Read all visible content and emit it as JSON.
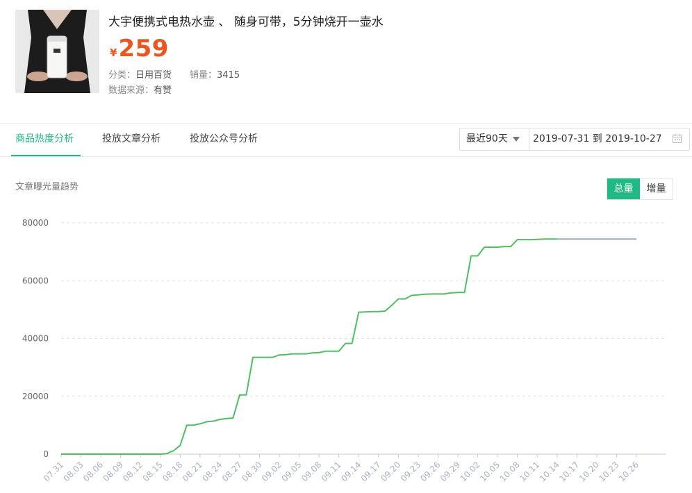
{
  "product": {
    "title": "大宇便携式电热水壶 、 随身可带，5分钟烧开一壶水",
    "currency": "¥",
    "price": "259",
    "category_label": "分类：",
    "category_value": "日用百货",
    "sales_label": "销量：",
    "sales_value": "3415",
    "source_label": "数据来源：",
    "source_value": "有赞",
    "price_color": "#f0541e"
  },
  "tabs": [
    {
      "label": "商品热度分析",
      "active": true
    },
    {
      "label": "投放文章分析",
      "active": false
    },
    {
      "label": "投放公众号分析",
      "active": false
    }
  ],
  "range": {
    "preset": "最近90天",
    "dates": "2019-07-31 到 2019-10-27",
    "icon": "calendar-icon"
  },
  "section": {
    "title": "文章曝光量趋势",
    "toggle": {
      "total": "总量",
      "increment": "增量",
      "selected": "总量"
    }
  },
  "accent_color": "#1fba84",
  "chart_data": {
    "type": "line",
    "title": "",
    "xlabel": "",
    "ylabel": "",
    "ylim": [
      0,
      80000
    ],
    "yticks": [
      0,
      20000,
      40000,
      60000,
      80000
    ],
    "grid": true,
    "xtick_labels": [
      "07.31",
      "08.03",
      "08.06",
      "08.09",
      "08.12",
      "08.15",
      "08.18",
      "08.21",
      "08.24",
      "08.27",
      "08.30",
      "09.02",
      "09.05",
      "09.08",
      "09.11",
      "09.14",
      "09.17",
      "09.20",
      "09.23",
      "09.26",
      "09.29",
      "10.02",
      "10.05",
      "10.08",
      "10.11",
      "10.14",
      "10.17",
      "10.20",
      "10.23",
      "10.26"
    ],
    "series": [
      {
        "color": "#4cbf60",
        "x": [
          "07.31",
          "08.15",
          "08.16",
          "08.17",
          "08.18",
          "08.19",
          "08.20",
          "08.21",
          "08.22",
          "08.23",
          "08.24",
          "08.25",
          "08.26",
          "08.27",
          "08.28",
          "08.29",
          "08.30",
          "09.01",
          "09.02",
          "09.03",
          "09.04",
          "09.05",
          "09.06",
          "09.07",
          "09.08",
          "09.09",
          "09.10",
          "09.11",
          "09.12",
          "09.13",
          "09.14",
          "09.15",
          "09.16",
          "09.17",
          "09.18",
          "09.19",
          "09.20",
          "09.21",
          "09.22",
          "09.23",
          "09.24",
          "09.25",
          "09.26",
          "09.27",
          "09.28",
          "09.29",
          "09.30",
          "10.01",
          "10.02",
          "10.03",
          "10.04",
          "10.05",
          "10.06",
          "10.07",
          "10.08",
          "10.09",
          "10.10",
          "10.11",
          "10.12",
          "10.13",
          "10.14"
        ],
        "values": [
          0,
          0,
          200,
          1200,
          3000,
          10000,
          10000,
          10500,
          11200,
          11400,
          12000,
          12300,
          12500,
          20500,
          20500,
          33500,
          33500,
          33500,
          34300,
          34400,
          34700,
          34700,
          34700,
          35000,
          35100,
          35600,
          35600,
          35600,
          38300,
          38300,
          49100,
          49200,
          49300,
          49300,
          49500,
          51500,
          53700,
          53700,
          54900,
          55100,
          55300,
          55400,
          55400,
          55400,
          55800,
          55900,
          55900,
          68600,
          68600,
          71600,
          71600,
          71600,
          71800,
          71800,
          74200,
          74200,
          74200,
          74300,
          74400,
          74400,
          74400
        ]
      },
      {
        "color": "#9aa9bd",
        "x": [
          "10.14",
          "10.26"
        ],
        "values": [
          74400,
          74400
        ]
      }
    ]
  }
}
